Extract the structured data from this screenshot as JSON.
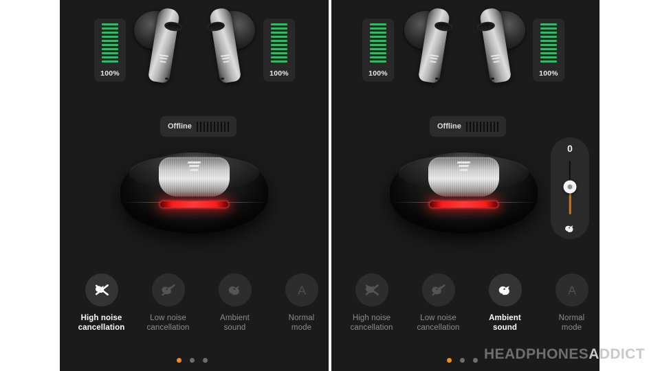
{
  "app": {
    "screen_title": "Edifier earbuds ANC control screens",
    "background_color": "#1b1b1b",
    "accent_color": "#ef8b1f",
    "battery_color": "#1fc65c",
    "led_color": "#ff2020"
  },
  "panels": [
    {
      "id": "left",
      "battery_left": {
        "percent_label": "100%",
        "bars_total": 10,
        "bars_filled": 10
      },
      "battery_right": {
        "percent_label": "100%",
        "bars_total": 10,
        "bars_filled": 10
      },
      "status_pill": {
        "label": "Offline",
        "signal_bars": 10
      },
      "slider": null,
      "modes": [
        {
          "label_line1": "High noise",
          "label_line2": "cancellation",
          "icon": "bird-crossed-out-icon",
          "active": true
        },
        {
          "label_line1": "Low noise",
          "label_line2": "cancellation",
          "icon": "bird-slashed-icon",
          "active": false
        },
        {
          "label_line1": "Ambient",
          "label_line2": "sound",
          "icon": "bird-icon",
          "active": false
        },
        {
          "label_line1": "Normal",
          "label_line2": "mode",
          "icon": "letter-a-icon",
          "active": false
        }
      ],
      "pager": {
        "count": 3,
        "active_index": 0
      }
    },
    {
      "id": "right",
      "battery_left": {
        "percent_label": "100%",
        "bars_total": 10,
        "bars_filled": 10
      },
      "battery_right": {
        "percent_label": "100%",
        "bars_total": 10,
        "bars_filled": 10
      },
      "status_pill": {
        "label": "Offline",
        "signal_bars": 10
      },
      "slider": {
        "value_label": "0",
        "min": -5,
        "max": 5,
        "icon": "bird-icon"
      },
      "modes": [
        {
          "label_line1": "High noise",
          "label_line2": "cancellation",
          "icon": "bird-crossed-out-icon",
          "active": false
        },
        {
          "label_line1": "Low noise",
          "label_line2": "cancellation",
          "icon": "bird-slashed-icon",
          "active": false
        },
        {
          "label_line1": "Ambient",
          "label_line2": "sound",
          "icon": "bird-icon",
          "active": true
        },
        {
          "label_line1": "Normal",
          "label_line2": "mode",
          "icon": "letter-a-icon",
          "active": false
        }
      ],
      "pager": {
        "count": 3,
        "active_index": 0
      }
    }
  ],
  "watermark": {
    "part1": "HEADPHONES",
    "part2": "ADDICT"
  }
}
